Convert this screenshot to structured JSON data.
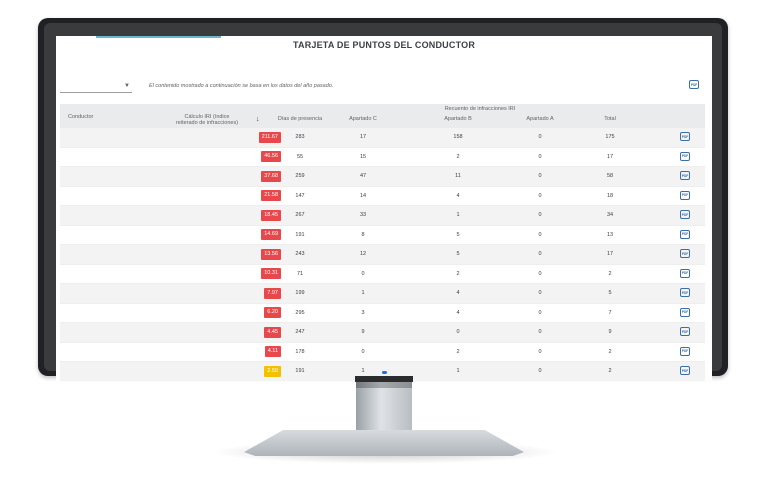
{
  "page": {
    "title": "TARJETA DE PUNTOS DEL CONDUCTOR"
  },
  "filter": {
    "note": "El contenido mostrado a continuación se basa en los datos del año pasado."
  },
  "table": {
    "group_header": "Recuento de infracciones IRI",
    "columns": {
      "conductor": "Conductor",
      "iri_line1": "Cálculo IRI (índice",
      "iri_line2": "reiterado de infracciones)",
      "days": "Días de presencia",
      "c": "Apartado C",
      "b": "Apartado B",
      "a": "Apartado A",
      "total": "Total"
    },
    "rows": [
      {
        "iri": "211.67",
        "days": "283",
        "c": "17",
        "b": "158",
        "a": "0",
        "total": "175",
        "level": "red"
      },
      {
        "iri": "46.56",
        "days": "55",
        "c": "15",
        "b": "2",
        "a": "0",
        "total": "17",
        "level": "red"
      },
      {
        "iri": "37.68",
        "days": "259",
        "c": "47",
        "b": "11",
        "a": "0",
        "total": "58",
        "level": "red"
      },
      {
        "iri": "21.58",
        "days": "147",
        "c": "14",
        "b": "4",
        "a": "0",
        "total": "18",
        "level": "red"
      },
      {
        "iri": "18.45",
        "days": "267",
        "c": "33",
        "b": "1",
        "a": "0",
        "total": "34",
        "level": "red"
      },
      {
        "iri": "14.69",
        "days": "191",
        "c": "8",
        "b": "5",
        "a": "0",
        "total": "13",
        "level": "red"
      },
      {
        "iri": "13.56",
        "days": "243",
        "c": "12",
        "b": "5",
        "a": "0",
        "total": "17",
        "level": "red"
      },
      {
        "iri": "10.31",
        "days": "71",
        "c": "0",
        "b": "2",
        "a": "0",
        "total": "2",
        "level": "red"
      },
      {
        "iri": "7.97",
        "days": "199",
        "c": "1",
        "b": "4",
        "a": "0",
        "total": "5",
        "level": "red"
      },
      {
        "iri": "6.20",
        "days": "295",
        "c": "3",
        "b": "4",
        "a": "0",
        "total": "7",
        "level": "red"
      },
      {
        "iri": "4.45",
        "days": "247",
        "c": "9",
        "b": "0",
        "a": "0",
        "total": "9",
        "level": "red"
      },
      {
        "iri": "4.11",
        "days": "178",
        "c": "0",
        "b": "2",
        "a": "0",
        "total": "2",
        "level": "red"
      },
      {
        "iri": "2.50",
        "days": "191",
        "c": "1",
        "b": "1",
        "a": "0",
        "total": "2",
        "level": "yellow"
      }
    ]
  },
  "colors": {
    "red": "#e8474b",
    "yellow": "#f2c200",
    "accent": "#6ab7c9",
    "icon": "#3b6ea5"
  },
  "icons": {
    "sort": "arrow-down-icon",
    "report": "pdf-icon",
    "dropdown": "chevron-down-icon"
  }
}
